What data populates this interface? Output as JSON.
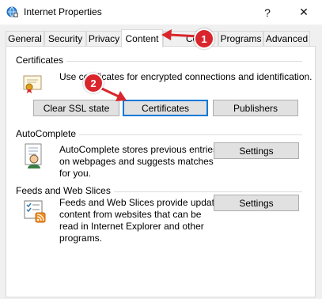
{
  "window": {
    "title": "Internet Properties",
    "help_glyph": "?",
    "close_glyph": "✕"
  },
  "tabs": [
    {
      "label": "General"
    },
    {
      "label": "Security"
    },
    {
      "label": "Privacy"
    },
    {
      "label": "Content",
      "active": true
    },
    {
      "label": "Con..."
    },
    {
      "label": "Programs"
    },
    {
      "label": "Advanced"
    }
  ],
  "certificates": {
    "group_label": "Certificates",
    "description": "Use certificates for encrypted connections and identification.",
    "clear_ssl_label": "Clear SSL state",
    "certificates_label": "Certificates",
    "publishers_label": "Publishers"
  },
  "autocomplete": {
    "group_label": "AutoComplete",
    "description_lines": [
      "AutoComplete stores previous entries",
      "on webpages and suggests matches",
      "for you."
    ],
    "settings_label": "Settings"
  },
  "feeds": {
    "group_label": "Feeds and Web Slices",
    "description_lines": [
      "Feeds and Web Slices provide updated",
      "content from websites that can be",
      "read in Internet Explorer and other",
      "programs."
    ],
    "settings_label": "Settings"
  },
  "annotations": {
    "badge1": "1",
    "badge2": "2"
  },
  "colors": {
    "accent_focus": "#0078d7",
    "annotation_red": "#d9262d"
  }
}
